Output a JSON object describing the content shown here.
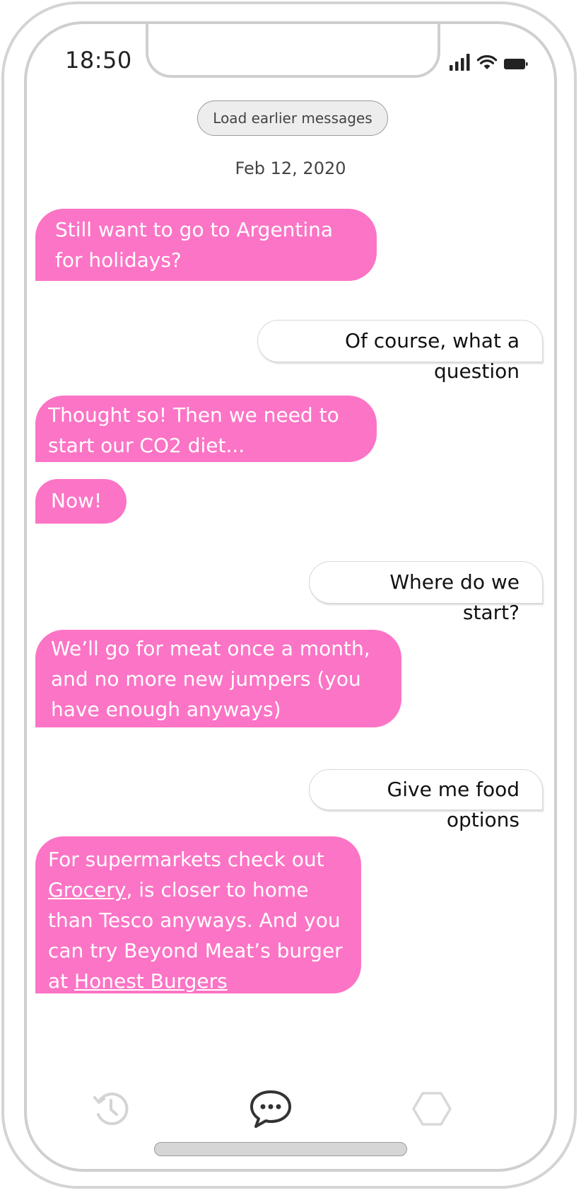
{
  "status_bar": {
    "time": "18:50",
    "signal_icon": "cellular-signal-icon",
    "wifi_icon": "wifi-icon",
    "battery_icon": "battery-icon"
  },
  "chat": {
    "load_earlier_label": "Load earlier messages",
    "date_separator": "Feb 12, 2020",
    "messages": [
      {
        "direction": "incoming",
        "text": "Still want to go to Argentina for holidays?"
      },
      {
        "direction": "outgoing",
        "text": "Of course, what a question"
      },
      {
        "direction": "incoming",
        "text": "Thought so! Then we need to start our CO2 diet..."
      },
      {
        "direction": "incoming",
        "text": "Now!"
      },
      {
        "direction": "outgoing",
        "text": "Where do we start?"
      },
      {
        "direction": "incoming",
        "text": "We’ll go for meat once a month, and no more new jumpers (you have enough anyways)"
      },
      {
        "direction": "outgoing",
        "text": "Give me food options"
      },
      {
        "direction": "incoming",
        "parts": {
          "p1": "For supermarkets check out",
          "link1": "Grocery",
          "p2": ", is closer to home than Tesco anyways. And you can try Beyond Meat’s burger at",
          "link2": "Honest Burgers"
        }
      }
    ]
  },
  "tabbar": {
    "tabs": [
      {
        "icon": "history-icon",
        "active": false
      },
      {
        "icon": "chat-bubble-icon",
        "active": true
      },
      {
        "icon": "hexagon-icon",
        "active": false
      }
    ]
  },
  "colors": {
    "incoming_bubble": "#fc74c5",
    "outgoing_bubble": "#ffffff",
    "frame": "#cfcfcf"
  }
}
